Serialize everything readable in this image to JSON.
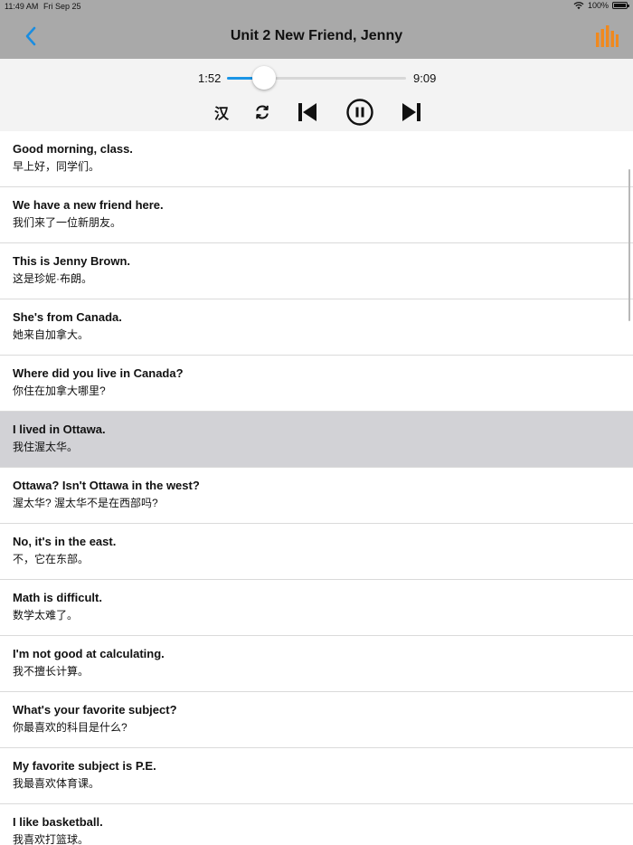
{
  "status_bar": {
    "time": "11:49 AM",
    "date": "Fri Sep 25",
    "battery": "100%"
  },
  "nav": {
    "title": "Unit 2 New Friend, Jenny",
    "accent_color": "#f0891e",
    "back_color": "#1a8de0"
  },
  "player": {
    "current_time": "1:52",
    "total_time": "9:09",
    "progress": 0.205,
    "translation_toggle_label": "汉"
  },
  "sentences": [
    {
      "en": "Good morning, class.",
      "zh": "早上好，同学们。"
    },
    {
      "en": "We have a new friend here.",
      "zh": "我们来了一位新朋友。"
    },
    {
      "en": "This is Jenny Brown.",
      "zh": "这是珍妮·布朗。"
    },
    {
      "en": "She's from Canada.",
      "zh": "她来自加拿大。"
    },
    {
      "en": "Where did you live in Canada?",
      "zh": "你住在加拿大哪里?"
    },
    {
      "en": "I lived in Ottawa.",
      "zh": "我住渥太华。",
      "selected": true
    },
    {
      "en": "Ottawa? Isn't Ottawa in the west?",
      "zh": "渥太华? 渥太华不是在西部吗?"
    },
    {
      "en": "No, it's in the east.",
      "zh": "不，它在东部。"
    },
    {
      "en": "Math is difficult.",
      "zh": "数学太难了。"
    },
    {
      "en": "I'm not good at calculating.",
      "zh": "我不擅长计算。"
    },
    {
      "en": "What's your favorite subject?",
      "zh": "你最喜欢的科目是什么?"
    },
    {
      "en": "My favorite subject is P.E.",
      "zh": "我最喜欢体育课。"
    },
    {
      "en": "I like basketball.",
      "zh": "我喜欢打篮球。"
    }
  ]
}
